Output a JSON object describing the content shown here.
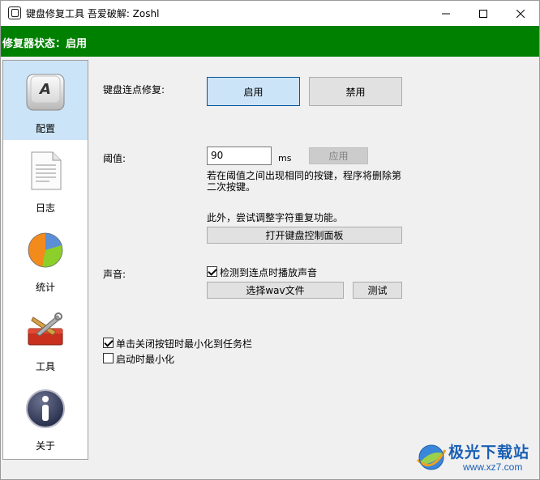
{
  "window": {
    "title": "键盘修复工具 吾爱破解: Zoshl"
  },
  "status": {
    "text": "修复器状态：启用"
  },
  "sidebar": {
    "items": [
      {
        "label": "配置",
        "icon": "keyboard-key-icon",
        "selected": true
      },
      {
        "label": "日志",
        "icon": "document-icon",
        "selected": false
      },
      {
        "label": "统计",
        "icon": "pie-chart-icon",
        "selected": false
      },
      {
        "label": "工具",
        "icon": "toolbox-icon",
        "selected": false
      },
      {
        "label": "关于",
        "icon": "info-icon",
        "selected": false
      }
    ]
  },
  "config": {
    "chatter_label": "键盘连点修复:",
    "enable_label": "启用",
    "disable_label": "禁用",
    "threshold_label": "阈值:",
    "threshold_value": "90",
    "threshold_unit": "ms",
    "apply_label": "应用",
    "threshold_desc": "若在阈值之间出现相同的按键，程序将删除第二次按键。",
    "repeat_desc": "此外，尝试调整字符重复功能。",
    "open_panel_label": "打开键盘控制面板",
    "sound_label": "声音:",
    "sound_check_label": "检测到连点时播放声音",
    "sound_check_checked": true,
    "choose_wav_label": "选择wav文件",
    "test_label": "测试",
    "minimize_close_label": "单击关闭按钮时最小化到任务栏",
    "minimize_close_checked": true,
    "start_minimized_label": "启动时最小化",
    "start_minimized_checked": false
  },
  "watermark": {
    "title": "极光下载站",
    "url": "www.xz7.com"
  },
  "colors": {
    "status_bg": "#008000",
    "selected_bg": "#cce4f7",
    "button_bg": "#e1e1e1"
  }
}
